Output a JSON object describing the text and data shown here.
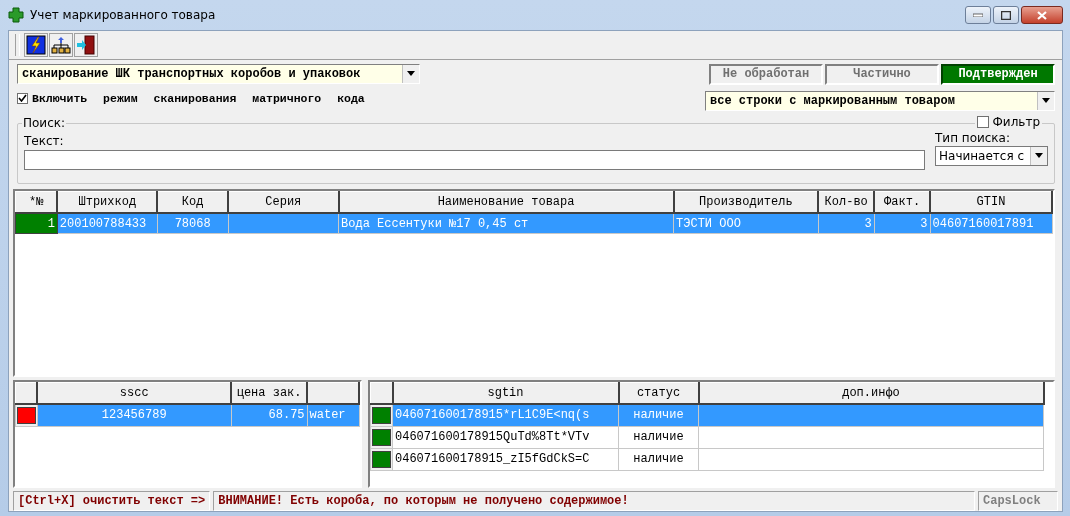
{
  "window": {
    "title": "Учет маркированного товара"
  },
  "mode_combo": {
    "value": "сканирование ШК транспортных коробов и упаковок"
  },
  "matrix_mode": {
    "label": "Включить режим сканирования матричного кода",
    "checked": true
  },
  "status_buttons": [
    {
      "label": "Не обработан",
      "selected": false
    },
    {
      "label": "Частично",
      "selected": false
    },
    {
      "label": "Подтвержден",
      "selected": true
    }
  ],
  "rows_filter_combo": {
    "value": "все строки с маркированным товаром"
  },
  "search": {
    "group_label": "Поиск:",
    "text_label": "Текст:",
    "filter": {
      "label": "Фильтр",
      "checked": false
    },
    "type_label": "Тип поиска:",
    "type_value": "Начинается с"
  },
  "main_table": {
    "columns": [
      "*№",
      "Штрихкод",
      "Код",
      "Серия",
      "Наименование товара",
      "Производитель",
      "Кол-во",
      "Факт.",
      "GTIN"
    ],
    "rows": [
      {
        "cells": [
          "1",
          "200100788433",
          "78068",
          "",
          "Вода Ессентуки №17 0,45 ст",
          "ТЭСТИ ООО",
          "3",
          "3",
          "04607160017891"
        ],
        "color": "#008000",
        "selected": true
      }
    ]
  },
  "sscc_table": {
    "columns": [
      "",
      "sscc",
      "цена зак.",
      ""
    ],
    "rows": [
      {
        "cells": [
          "",
          "123456789",
          "68.75",
          "water"
        ],
        "color": "#ff0000",
        "selected": true
      }
    ]
  },
  "sgtin_table": {
    "columns": [
      "",
      "sgtin",
      "статус",
      "доп.инфо"
    ],
    "rows": [
      {
        "cells": [
          "",
          "046071600178915*rL1C9E<nq(s",
          "наличие",
          ""
        ],
        "color": "#008000",
        "selected": true
      },
      {
        "cells": [
          "",
          "046071600178915QuTd%8Tt*VTv",
          "наличие",
          ""
        ],
        "color": "#008000",
        "selected": false
      },
      {
        "cells": [
          "",
          "046071600178915_zI5fGdCkS=C",
          "наличие",
          ""
        ],
        "color": "#008000",
        "selected": false
      }
    ]
  },
  "status_bar": {
    "hint": "[Ctrl+X] очистить текст =>",
    "warning": "ВНИМАНИЕ! Есть короба, по которым не получено содержимое!",
    "capslock": "CapsLock"
  }
}
